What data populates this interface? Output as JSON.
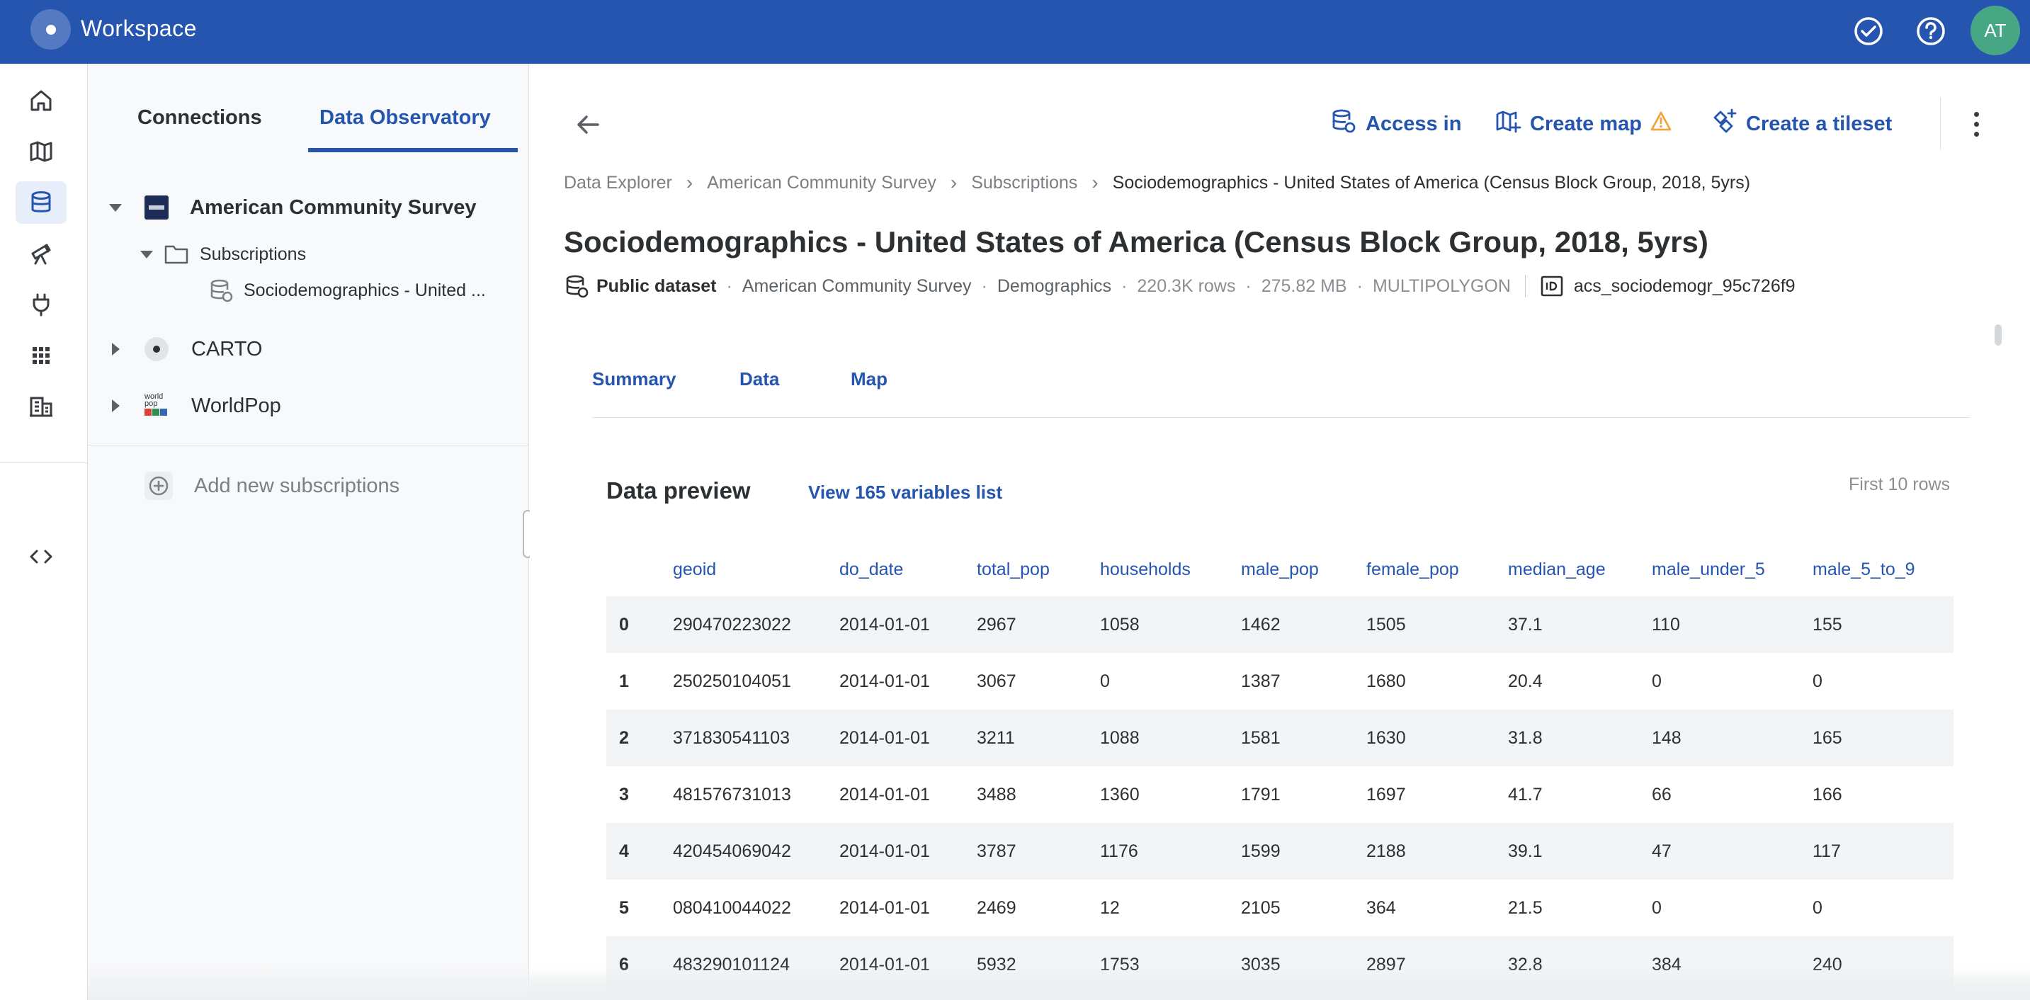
{
  "topbar": {
    "app_title": "Workspace",
    "icons": [
      "check-circle-icon",
      "help-icon"
    ],
    "avatar_initials": "AT",
    "brand_color": "#2655b0"
  },
  "rail": {
    "items": [
      "home-icon",
      "map-icon",
      "data-icon",
      "telescope-icon",
      "plug-icon",
      "apps-icon",
      "building-icon",
      "code-icon"
    ],
    "active": "data-icon"
  },
  "explorer": {
    "tabs": [
      {
        "label": "Connections",
        "active": false
      },
      {
        "label": "Data Observatory",
        "active": true
      }
    ],
    "tree": {
      "providers": [
        {
          "label": "American Community Survey",
          "expanded": true
        },
        {
          "label": "CARTO",
          "expanded": false
        },
        {
          "label": "WorldPop",
          "expanded": false
        }
      ],
      "folder": "Subscriptions",
      "dataset": "Sociodemographics - United ..."
    },
    "worldpop_logo_text": "world pop",
    "add_label": "Add new subscriptions"
  },
  "main": {
    "actions": {
      "access": "Access in",
      "create_map": "Create map",
      "create_tileset": "Create a tileset"
    },
    "breadcrumb": [
      "Data Explorer",
      "American Community Survey",
      "Subscriptions",
      "Sociodemographics - United States of America (Census Block Group, 2018, 5yrs)"
    ],
    "title": "Sociodemographics - United States of America (Census Block Group, 2018, 5yrs)",
    "meta": {
      "type": "Public dataset",
      "provider": "American Community Survey",
      "category": "Demographics",
      "rows": "220.3K rows",
      "size": "275.82 MB",
      "geometry": "MULTIPOLYGON",
      "id": "acs_sociodemogr_95c726f9"
    },
    "tabs": [
      "Summary",
      "Data",
      "Map"
    ],
    "preview": {
      "title": "Data preview",
      "link": "View 165 variables list",
      "hint": "First 10 rows"
    },
    "table": {
      "columns": [
        "geoid",
        "do_date",
        "total_pop",
        "households",
        "male_pop",
        "female_pop",
        "median_age",
        "male_under_5",
        "male_5_to_9"
      ],
      "rows": [
        {
          "idx": "0",
          "cells": [
            "290470223022",
            "2014-01-01",
            "2967",
            "1058",
            "1462",
            "1505",
            "37.1",
            "110",
            "155"
          ]
        },
        {
          "idx": "1",
          "cells": [
            "250250104051",
            "2014-01-01",
            "3067",
            "0",
            "1387",
            "1680",
            "20.4",
            "0",
            "0"
          ]
        },
        {
          "idx": "2",
          "cells": [
            "371830541103",
            "2014-01-01",
            "3211",
            "1088",
            "1581",
            "1630",
            "31.8",
            "148",
            "165"
          ]
        },
        {
          "idx": "3",
          "cells": [
            "481576731013",
            "2014-01-01",
            "3488",
            "1360",
            "1791",
            "1697",
            "41.7",
            "66",
            "166"
          ]
        },
        {
          "idx": "4",
          "cells": [
            "420454069042",
            "2014-01-01",
            "3787",
            "1176",
            "1599",
            "2188",
            "39.1",
            "47",
            "117"
          ]
        },
        {
          "idx": "5",
          "cells": [
            "080410044022",
            "2014-01-01",
            "2469",
            "12",
            "2105",
            "364",
            "21.5",
            "0",
            "0"
          ]
        },
        {
          "idx": "6",
          "cells": [
            "483290101124",
            "2014-01-01",
            "5932",
            "1753",
            "3035",
            "2897",
            "32.8",
            "384",
            "240"
          ]
        }
      ]
    }
  }
}
